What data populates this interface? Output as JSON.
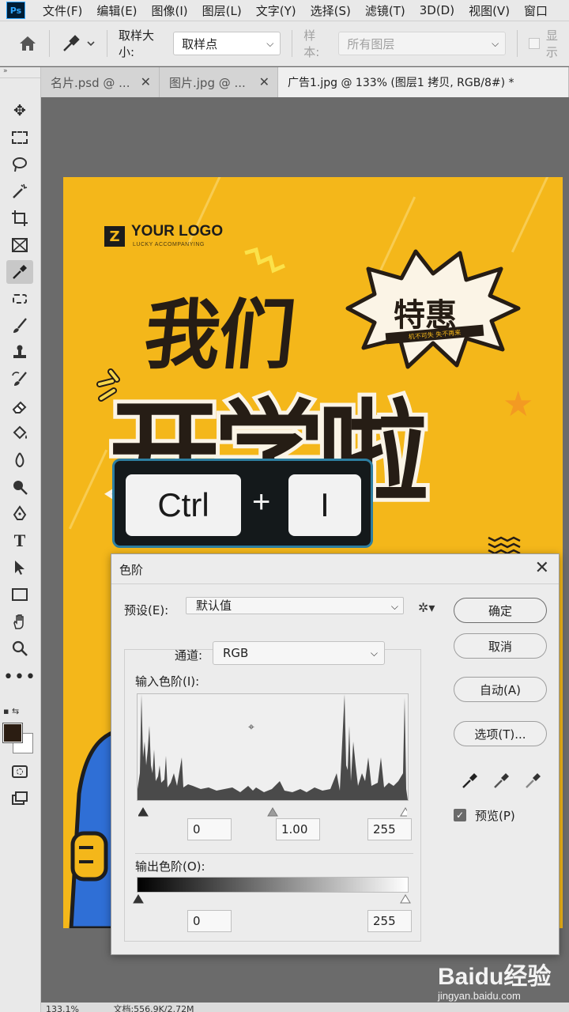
{
  "app": {
    "logo": "Ps"
  },
  "menu": [
    "文件(F)",
    "编辑(E)",
    "图像(I)",
    "图层(L)",
    "文字(Y)",
    "选择(S)",
    "滤镜(T)",
    "3D(D)",
    "视图(V)",
    "窗口"
  ],
  "options": {
    "sample_size_label": "取样大小:",
    "sample_size_value": "取样点",
    "sample_label": "样本:",
    "sample_value": "所有图层",
    "show_ring_label": "显示"
  },
  "tabs": [
    {
      "label": "名片.psd @ ..."
    },
    {
      "label": "图片.jpg @ ..."
    },
    {
      "label": "广告1.jpg @ 133% (图层1 拷贝, RGB/8#) *"
    }
  ],
  "canvas": {
    "logo_letter": "Z",
    "logo_text": "YOUR LOGO",
    "logo_sub": "LUCKY ACCOMPANYING",
    "title_line1": "我们",
    "title_line2": "开学啦",
    "burst_text": "特惠",
    "burst_tag": "机不可失 失不再来"
  },
  "shortcut": {
    "key1": "Ctrl",
    "plus": "+",
    "key2": "I"
  },
  "dialog": {
    "title": "色阶",
    "preset_label": "预设(E):",
    "preset_value": "默认值",
    "channel_label": "通道:",
    "channel_value": "RGB",
    "input_label": "输入色阶(I):",
    "input_black": "0",
    "input_gamma": "1.00",
    "input_white": "255",
    "output_label": "输出色阶(O):",
    "output_black": "0",
    "output_white": "255",
    "btn_ok": "确定",
    "btn_cancel": "取消",
    "btn_auto": "自动(A)",
    "btn_options": "选项(T)...",
    "preview_label": "预览(P)",
    "preview_checked": true
  },
  "status": {
    "zoom": "133.1%",
    "doc": "文档:556.9K/2.72M"
  },
  "watermark": {
    "main": "Baidu经验",
    "sub": "jingyan.baidu.com"
  },
  "colors": {
    "canvas_bg": "#f4b71a",
    "dark_text": "#261d15",
    "accent_blue": "#2d7ea1"
  }
}
